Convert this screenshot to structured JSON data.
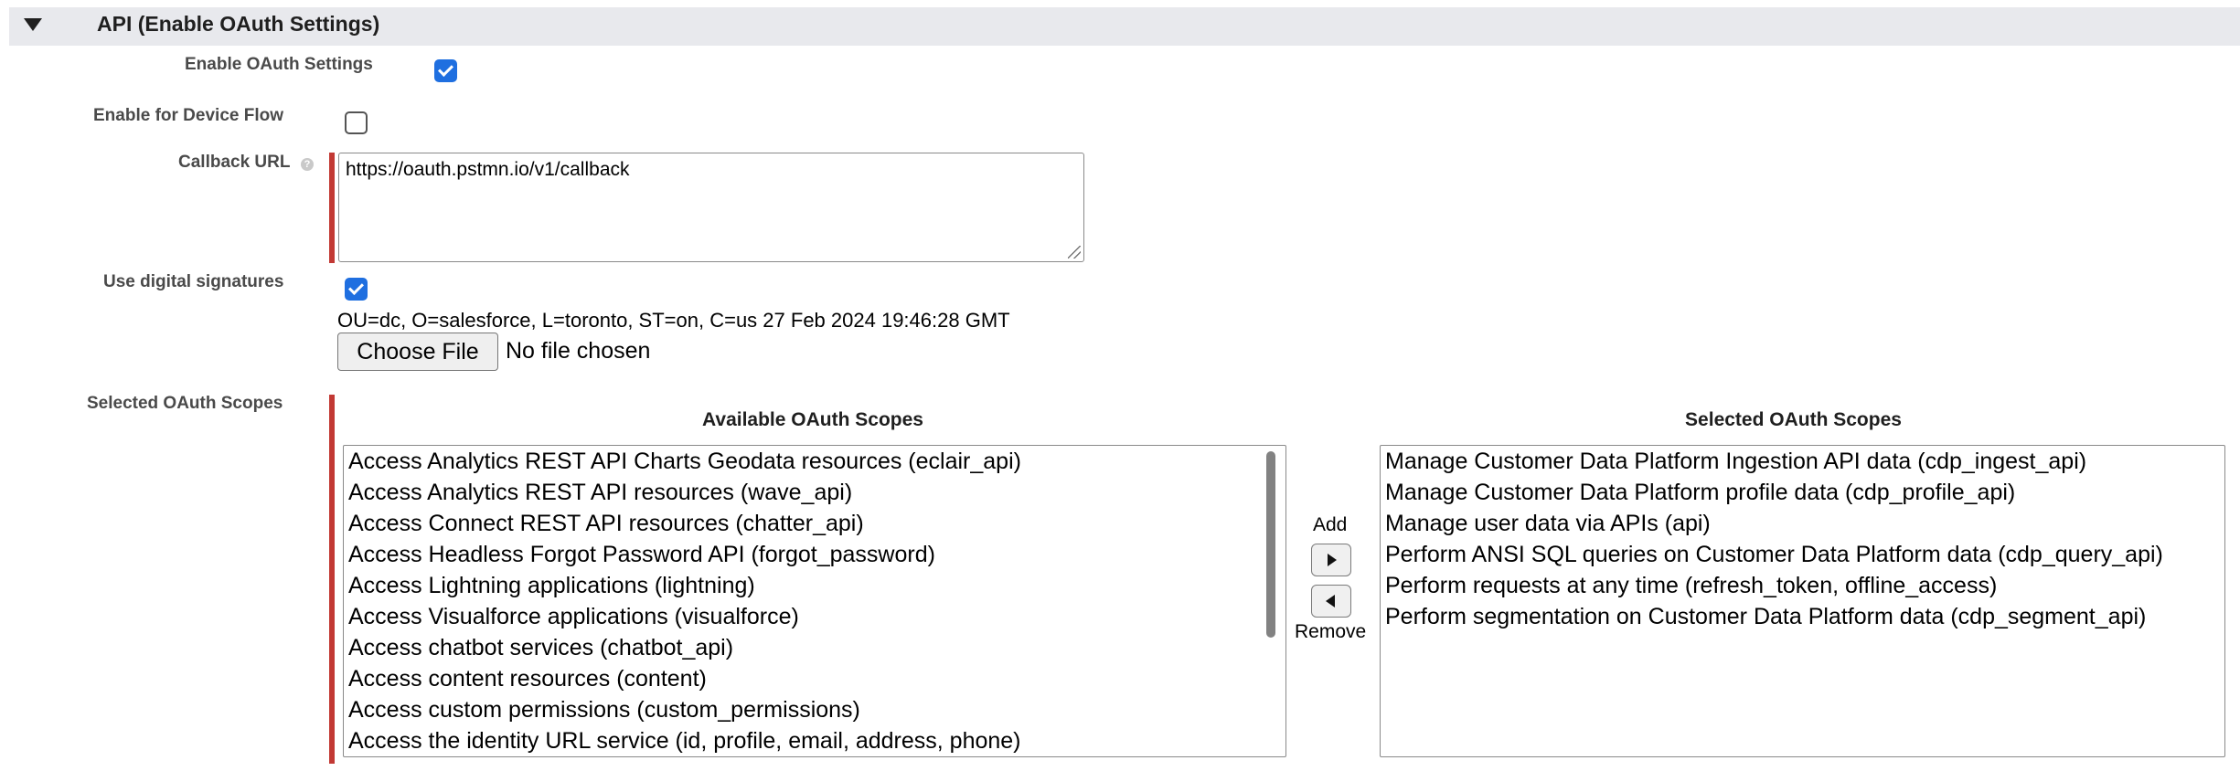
{
  "section": {
    "title": "API (Enable OAuth Settings)"
  },
  "fields": {
    "enable_oauth_label": "Enable OAuth Settings",
    "enable_oauth_checked": true,
    "device_flow_label": "Enable for Device Flow",
    "device_flow_checked": false,
    "callback_url_label": "Callback URL",
    "callback_url_value": "https://oauth.pstmn.io/v1/callback",
    "digital_signatures_label": "Use digital signatures",
    "digital_signatures_checked": true,
    "certificate_info": "OU=dc, O=salesforce, L=toronto, ST=on, C=us 27 Feb 2024 19:46:28 GMT",
    "choose_file_label": "Choose File",
    "no_file_text": "No file chosen",
    "oauth_scopes_label": "Selected OAuth Scopes"
  },
  "scopes": {
    "available_heading": "Available OAuth Scopes",
    "selected_heading": "Selected OAuth Scopes",
    "add_label": "Add",
    "remove_label": "Remove",
    "available": [
      "Access Analytics REST API Charts Geodata resources (eclair_api)",
      "Access Analytics REST API resources (wave_api)",
      "Access Connect REST API resources (chatter_api)",
      "Access Headless Forgot Password API (forgot_password)",
      "Access Lightning applications (lightning)",
      "Access Visualforce applications (visualforce)",
      "Access chatbot services (chatbot_api)",
      "Access content resources (content)",
      "Access custom permissions (custom_permissions)",
      "Access the identity URL service (id, profile, email, address, phone)"
    ],
    "selected": [
      "Manage Customer Data Platform Ingestion API data (cdp_ingest_api)",
      "Manage Customer Data Platform profile data (cdp_profile_api)",
      "Manage user data via APIs (api)",
      "Perform ANSI SQL queries on Customer Data Platform data (cdp_query_api)",
      "Perform requests at any time (refresh_token, offline_access)",
      "Perform segmentation on Customer Data Platform data (cdp_segment_api)"
    ]
  },
  "colors": {
    "required_indicator": "#c23934",
    "checkbox_checked": "#1f6fe0",
    "section_header_bg": "#e8e9ed"
  }
}
